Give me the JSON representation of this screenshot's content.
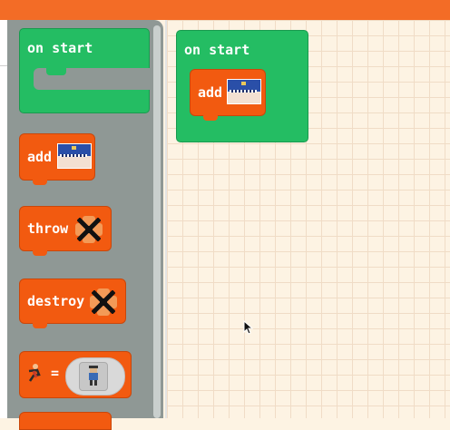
{
  "flyout": {
    "blocks": [
      {
        "label": "on start",
        "kind": "event"
      },
      {
        "label": "add",
        "kind": "statement",
        "arg": "sprite-image"
      },
      {
        "label": "throw",
        "kind": "statement",
        "arg": "projectile-image"
      },
      {
        "label": "destroy",
        "kind": "statement",
        "arg": "projectile-image"
      },
      {
        "label": "=",
        "kind": "set-variable",
        "icon": "player-icon",
        "arg": "sprite-picker"
      }
    ]
  },
  "workspace": {
    "on_start": {
      "label": "on start"
    },
    "add": {
      "label": "add",
      "arg": "sprite-image"
    }
  },
  "colors": {
    "topbar": "#f36c26",
    "event": "#24bd63",
    "statement": "#f25a10",
    "flyout": "#8f9895",
    "workspace": "#fdf3e3"
  }
}
